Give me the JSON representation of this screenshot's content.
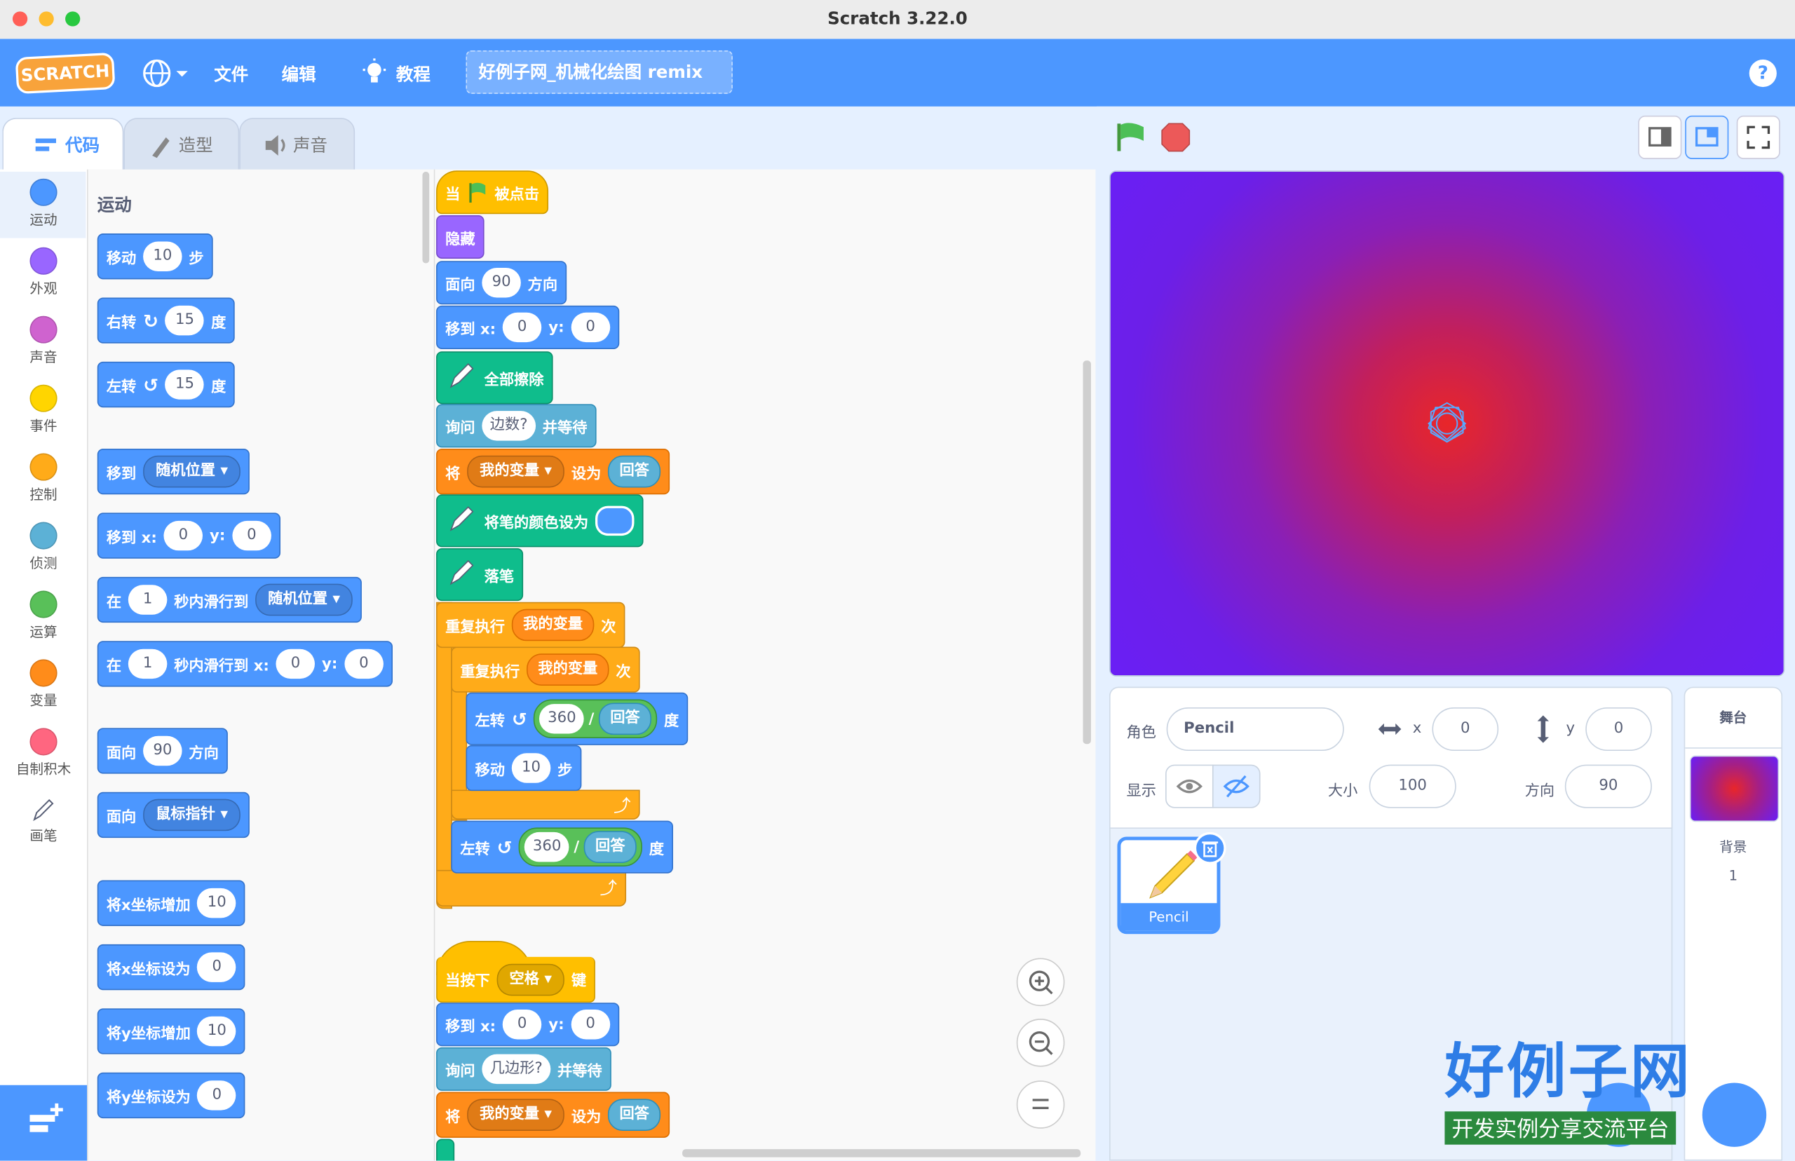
{
  "window": {
    "title": "Scratch 3.22.0"
  },
  "menubar": {
    "logo": "SCRATCH",
    "file": "文件",
    "edit": "编辑",
    "tutorials": "教程",
    "project_title": "好例子网_机械化绘图 remix",
    "help": "?"
  },
  "tabs": {
    "code": "代码",
    "costumes": "造型",
    "sounds": "声音"
  },
  "categories": [
    {
      "label": "运动",
      "color": "#4c97ff"
    },
    {
      "label": "外观",
      "color": "#9966ff"
    },
    {
      "label": "声音",
      "color": "#cf63cf"
    },
    {
      "label": "事件",
      "color": "#ffd500"
    },
    {
      "label": "控制",
      "color": "#ffab19"
    },
    {
      "label": "侦测",
      "color": "#5cb1d6"
    },
    {
      "label": "运算",
      "color": "#59c059"
    },
    {
      "label": "变量",
      "color": "#ff8c1a"
    },
    {
      "label": "自制积木",
      "color": "#ff6680"
    },
    {
      "label": "画笔",
      "color": "#0fbd8c"
    }
  ],
  "palette": {
    "section_title": "运动",
    "move": {
      "a": "移动",
      "n": "10",
      "b": "步"
    },
    "turn_right": {
      "a": "右转",
      "n": "15",
      "b": "度"
    },
    "turn_left": {
      "a": "左转",
      "n": "15",
      "b": "度"
    },
    "goto": {
      "a": "移到",
      "dd": "随机位置"
    },
    "goto_xy": {
      "a": "移到 x:",
      "x": "0",
      "b": "y:",
      "y": "0"
    },
    "glide": {
      "a": "在",
      "n": "1",
      "b": "秒内滑行到",
      "dd": "随机位置"
    },
    "glide_xy": {
      "a": "在",
      "n": "1",
      "b": "秒内滑行到 x:",
      "x": "0",
      "c": "y:",
      "y": "0"
    },
    "point_dir": {
      "a": "面向",
      "n": "90",
      "b": "方向"
    },
    "point_towards": {
      "a": "面向",
      "dd": "鼠标指针"
    },
    "change_x": {
      "a": "将x坐标增加",
      "n": "10"
    },
    "set_x": {
      "a": "将x坐标设为",
      "n": "0"
    },
    "change_y": {
      "a": "将y坐标增加",
      "n": "10"
    },
    "set_y": {
      "a": "将y坐标设为",
      "n": "0"
    }
  },
  "script": {
    "when_flag": {
      "a": "当",
      "b": "被点击"
    },
    "hide": "隐藏",
    "point_dir": {
      "a": "面向",
      "n": "90",
      "b": "方向"
    },
    "goto_xy": {
      "a": "移到 x:",
      "x": "0",
      "b": "y:",
      "y": "0"
    },
    "clear": "全部擦除",
    "ask": {
      "a": "询问",
      "q": "边数?",
      "b": "并等待"
    },
    "set_var": {
      "a": "将",
      "var": "我的变量",
      "b": "设为",
      "ans": "回答"
    },
    "set_pen_color": "将笔的颜色设为",
    "pen_down": "落笔",
    "repeat1": {
      "a": "重复执行",
      "var": "我的变量",
      "b": "次"
    },
    "repeat2": {
      "a": "重复执行",
      "var": "我的变量",
      "b": "次"
    },
    "turn1": {
      "a": "左转",
      "n": "360",
      "slash": "/",
      "ans": "回答",
      "b": "度"
    },
    "move1": {
      "a": "移动",
      "n": "10",
      "b": "步"
    },
    "turn2": {
      "a": "左转",
      "n": "360",
      "slash": "/",
      "ans": "回答",
      "b": "度"
    },
    "when_key": {
      "a": "当按下",
      "dd": "空格",
      "b": "键"
    },
    "goto_xy2": {
      "a": "移到 x:",
      "x": "0",
      "b": "y:",
      "y": "0"
    },
    "ask2": {
      "a": "询问",
      "q": "几边形?",
      "b": "并等待"
    },
    "set_var2": {
      "a": "将",
      "var": "我的变量",
      "b": "设为",
      "ans": "回答"
    }
  },
  "sprite_info": {
    "sprite_label": "角色",
    "sprite_name": "Pencil",
    "x_label": "x",
    "x": "0",
    "y_label": "y",
    "y": "0",
    "show_label": "显示",
    "size_label": "大小",
    "size": "100",
    "direction_label": "方向",
    "direction": "90"
  },
  "sprites": [
    {
      "name": "Pencil"
    }
  ],
  "stage_pane": {
    "title": "舞台",
    "backdrop_label": "背景",
    "backdrop_count": "1"
  },
  "watermark": {
    "title": "好例子网",
    "subtitle": "开发实例分享交流平台"
  }
}
